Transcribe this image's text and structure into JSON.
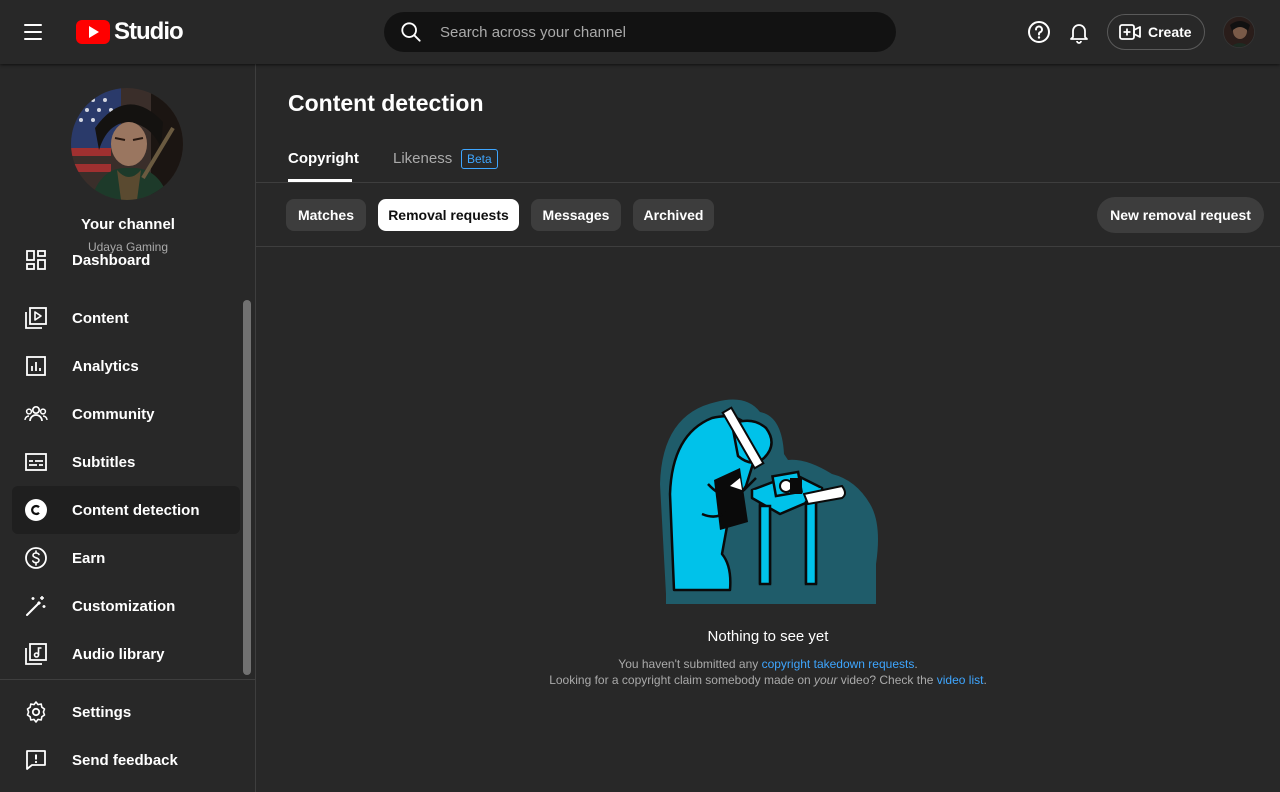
{
  "header": {
    "logo_text": "Studio",
    "search_placeholder": "Search across your channel",
    "create_label": "Create"
  },
  "channel": {
    "name": "Your channel",
    "handle": "Udaya Gaming"
  },
  "sidebar": {
    "items": [
      {
        "label": "Dashboard",
        "icon": "dashboard-icon"
      },
      {
        "label": "Content",
        "icon": "content-icon"
      },
      {
        "label": "Analytics",
        "icon": "analytics-icon"
      },
      {
        "label": "Community",
        "icon": "community-icon"
      },
      {
        "label": "Subtitles",
        "icon": "subtitles-icon"
      },
      {
        "label": "Content detection",
        "icon": "copyright-icon",
        "active": true
      },
      {
        "label": "Earn",
        "icon": "dollar-icon"
      },
      {
        "label": "Customization",
        "icon": "magic-wand-icon"
      },
      {
        "label": "Audio library",
        "icon": "audio-library-icon"
      }
    ],
    "bottom": [
      {
        "label": "Settings",
        "icon": "gear-icon"
      },
      {
        "label": "Send feedback",
        "icon": "feedback-icon"
      }
    ]
  },
  "main": {
    "title": "Content detection",
    "tabs": [
      {
        "label": "Copyright",
        "active": true
      },
      {
        "label": "Likeness",
        "badge": "Beta"
      }
    ],
    "chips": [
      {
        "label": "Matches"
      },
      {
        "label": "Removal requests",
        "selected": true
      },
      {
        "label": "Messages"
      },
      {
        "label": "Archived"
      }
    ],
    "new_request_label": "New removal request",
    "empty_state": {
      "title": "Nothing to see yet",
      "line1_prefix": "You haven't submitted any ",
      "line1_link": "copyright takedown requests",
      "line1_suffix": ".",
      "line2_prefix": "Looking for a copyright claim somebody made on ",
      "line2_emph": "your",
      "line2_middle": " video? Check the ",
      "line2_link": "video list",
      "line2_suffix": "."
    }
  },
  "colors": {
    "background": "#282828",
    "accent_link": "#3ea6ff",
    "brand_red": "#ff0000",
    "illustration_blue": "#00c2ea"
  }
}
